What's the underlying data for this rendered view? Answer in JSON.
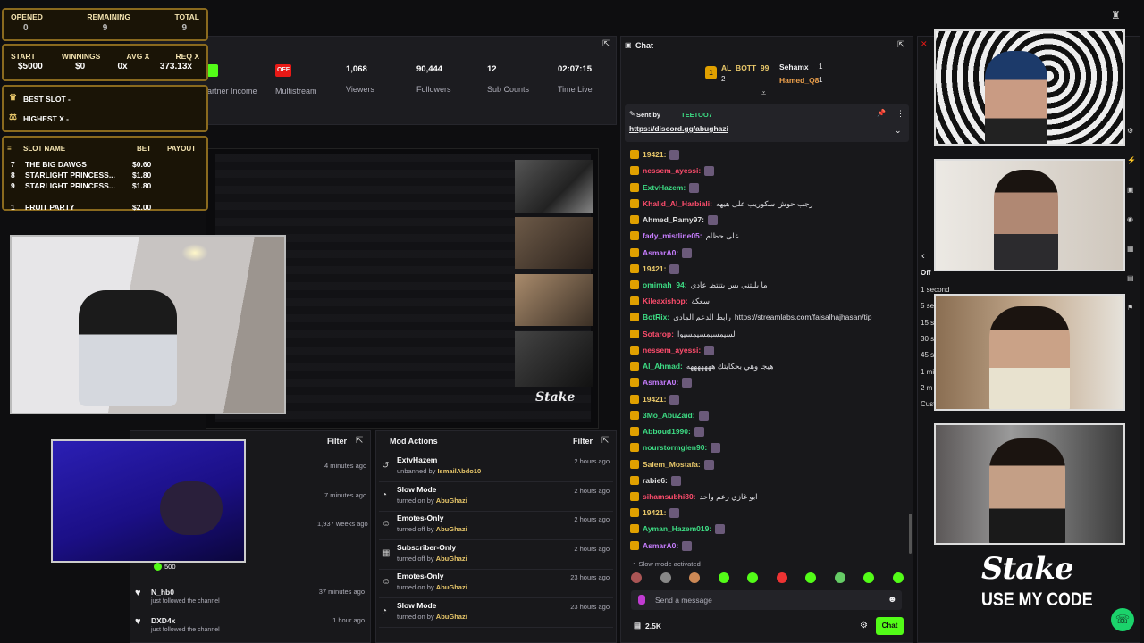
{
  "bonus": {
    "headers1": [
      "OPENED",
      "REMAINING",
      "TOTAL"
    ],
    "values1": [
      "0",
      "9",
      "9"
    ],
    "headers2": [
      "START",
      "WINNINGS",
      "AVG X",
      "REQ X"
    ],
    "values2": [
      "$5000",
      "$0",
      "0x",
      "373.13x"
    ],
    "best_slot": "BEST SLOT -",
    "highest_x": "HIGHEST X -",
    "table_headers": [
      "SLOT NAME",
      "BET",
      "PAYOUT"
    ],
    "slots": [
      {
        "num": "7",
        "name": "THE BIG DAWGS",
        "bet": "$0.60"
      },
      {
        "num": "8",
        "name": "STARLIGHT PRINCESS...",
        "bet": "$1.80"
      },
      {
        "num": "9",
        "name": "STARLIGHT PRINCESS...",
        "bet": "$1.80"
      },
      {
        "num": "1",
        "name": "FRUIT PARTY",
        "bet": "$2.00"
      }
    ]
  },
  "stats": [
    {
      "value": "OFF",
      "label": "Multistream"
    },
    {
      "value": "1,068",
      "label": "Viewers"
    },
    {
      "value": "90,444",
      "label": "Followers"
    },
    {
      "value": "12",
      "label": "Sub Counts"
    },
    {
      "value": "02:07:15",
      "label": "Time Live"
    }
  ],
  "partner_income": "artner Income",
  "activity": {
    "filter": "Filter",
    "times": [
      "4 minutes ago",
      "7 minutes ago",
      "1,937 weeks ago"
    ],
    "points": "500",
    "items": [
      {
        "name": "N_hb0",
        "sub": "just followed the channel",
        "time": "37 minutes ago"
      },
      {
        "name": "DXD4x",
        "sub": "just followed the channel",
        "time": "1 hour ago"
      }
    ]
  },
  "mod_actions": {
    "title": "Mod Actions",
    "filter": "Filter",
    "items": [
      {
        "icon": "↺",
        "title": "ExtvHazem",
        "action": "unbanned by",
        "by": "IsmailAbdo10",
        "time": "2 hours ago"
      },
      {
        "icon": "◔",
        "title": "Slow Mode",
        "action": "turned on by",
        "by": "AbuGhazi",
        "time": "2 hours ago"
      },
      {
        "icon": "☺",
        "title": "Emotes-Only",
        "action": "turned off by",
        "by": "AbuGhazi",
        "time": "2 hours ago"
      },
      {
        "icon": "▦",
        "title": "Subscriber-Only",
        "action": "turned off by",
        "by": "AbuGhazi",
        "time": "2 hours ago"
      },
      {
        "icon": "☺",
        "title": "Emotes-Only",
        "action": "turned on by",
        "by": "AbuGhazi",
        "time": "23 hours ago"
      },
      {
        "icon": "◔",
        "title": "Slow Mode",
        "action": "turned on by",
        "by": "AbuGhazi",
        "time": "23 hours ago"
      }
    ]
  },
  "chat": {
    "title": "Chat",
    "leaders": [
      {
        "rank": "1",
        "name": "AL_BOTT_99",
        "count": "2"
      },
      {
        "name": "Sehamx",
        "count": "1"
      },
      {
        "name": "Hamed_Q8",
        "count": "1"
      }
    ],
    "pinned_label": "Sent by",
    "pinned_user": "TEETOO7",
    "pinned_link": "https://discord.gg/abughazi",
    "messages": [
      {
        "user": "19421:",
        "color": "#e8c76a",
        "text": ""
      },
      {
        "user": "nessem_ayessi:",
        "color": "#ff4d6d",
        "text": ""
      },
      {
        "user": "ExtvHazem:",
        "color": "#3ddc84",
        "text": ""
      },
      {
        "user": "Khalid_Al_Harbiali:",
        "color": "#ff4d6d",
        "text": "رجب حوش سكوريب على هيهه"
      },
      {
        "user": "Ahmed_Ramy97:",
        "color": "#e0e0e0",
        "text": ""
      },
      {
        "user": "fady_mistline05:",
        "color": "#c77dff",
        "text": "على حظام"
      },
      {
        "user": "AsmarA0:",
        "color": "#c77dff",
        "text": ""
      },
      {
        "user": "19421:",
        "color": "#e8c76a",
        "text": ""
      },
      {
        "user": "omimah_94:",
        "color": "#3ddc84",
        "text": "ما يلبتني بس بتنتظ عادي"
      },
      {
        "user": "Kileaxishop:",
        "color": "#ff4d6d",
        "text": "سعكة"
      },
      {
        "user": "BotRix:",
        "color": "#3ddc84",
        "text": "رابط الدعم المادي",
        "link": "https://streamlabs.com/faisalhajhasan/tip"
      },
      {
        "user": "Sotarop:",
        "color": "#ff4d6d",
        "text": "لسيمسيمسيمسيوا"
      },
      {
        "user": "nessem_ayessi:",
        "color": "#ff4d6d",
        "text": ""
      },
      {
        "user": "Al_Ahmad:",
        "color": "#3ddc84",
        "text": "هيجا وهي بحكايتك هههههههه"
      },
      {
        "user": "AsmarA0:",
        "color": "#c77dff",
        "text": ""
      },
      {
        "user": "19421:",
        "color": "#e8c76a",
        "text": ""
      },
      {
        "user": "3Mo_AbuZaid:",
        "color": "#3ddc84",
        "text": ""
      },
      {
        "user": "Abboud1990:",
        "color": "#3ddc84",
        "text": ""
      },
      {
        "user": "nourstormglen90:",
        "color": "#3ddc84",
        "text": ""
      },
      {
        "user": "Salem_Mostafa:",
        "color": "#e8c76a",
        "text": ""
      },
      {
        "user": "rabie6:",
        "color": "#e0e0e0",
        "text": ""
      },
      {
        "user": "sihamsubhi80:",
        "color": "#ff4d6d",
        "text": "ابو غازي زعم واحد"
      },
      {
        "user": "19421:",
        "color": "#e8c76a",
        "text": ""
      },
      {
        "user": "Ayman_Hazem019:",
        "color": "#3ddc84",
        "text": ""
      },
      {
        "user": "AsmarA0:",
        "color": "#c77dff",
        "text": ""
      }
    ],
    "slow_mode": "Slow mode activated",
    "placeholder": "Send a message",
    "viewer_count": "2.5K",
    "send": "Chat"
  },
  "right_panel": {
    "off": "Off",
    "options": [
      "1 second",
      "5 se",
      "15 s",
      "30 s",
      "45 s",
      "1 mi",
      "2 m",
      "Custom"
    ]
  },
  "brand": {
    "logo": "Stake",
    "code": "USE MY CODE"
  }
}
